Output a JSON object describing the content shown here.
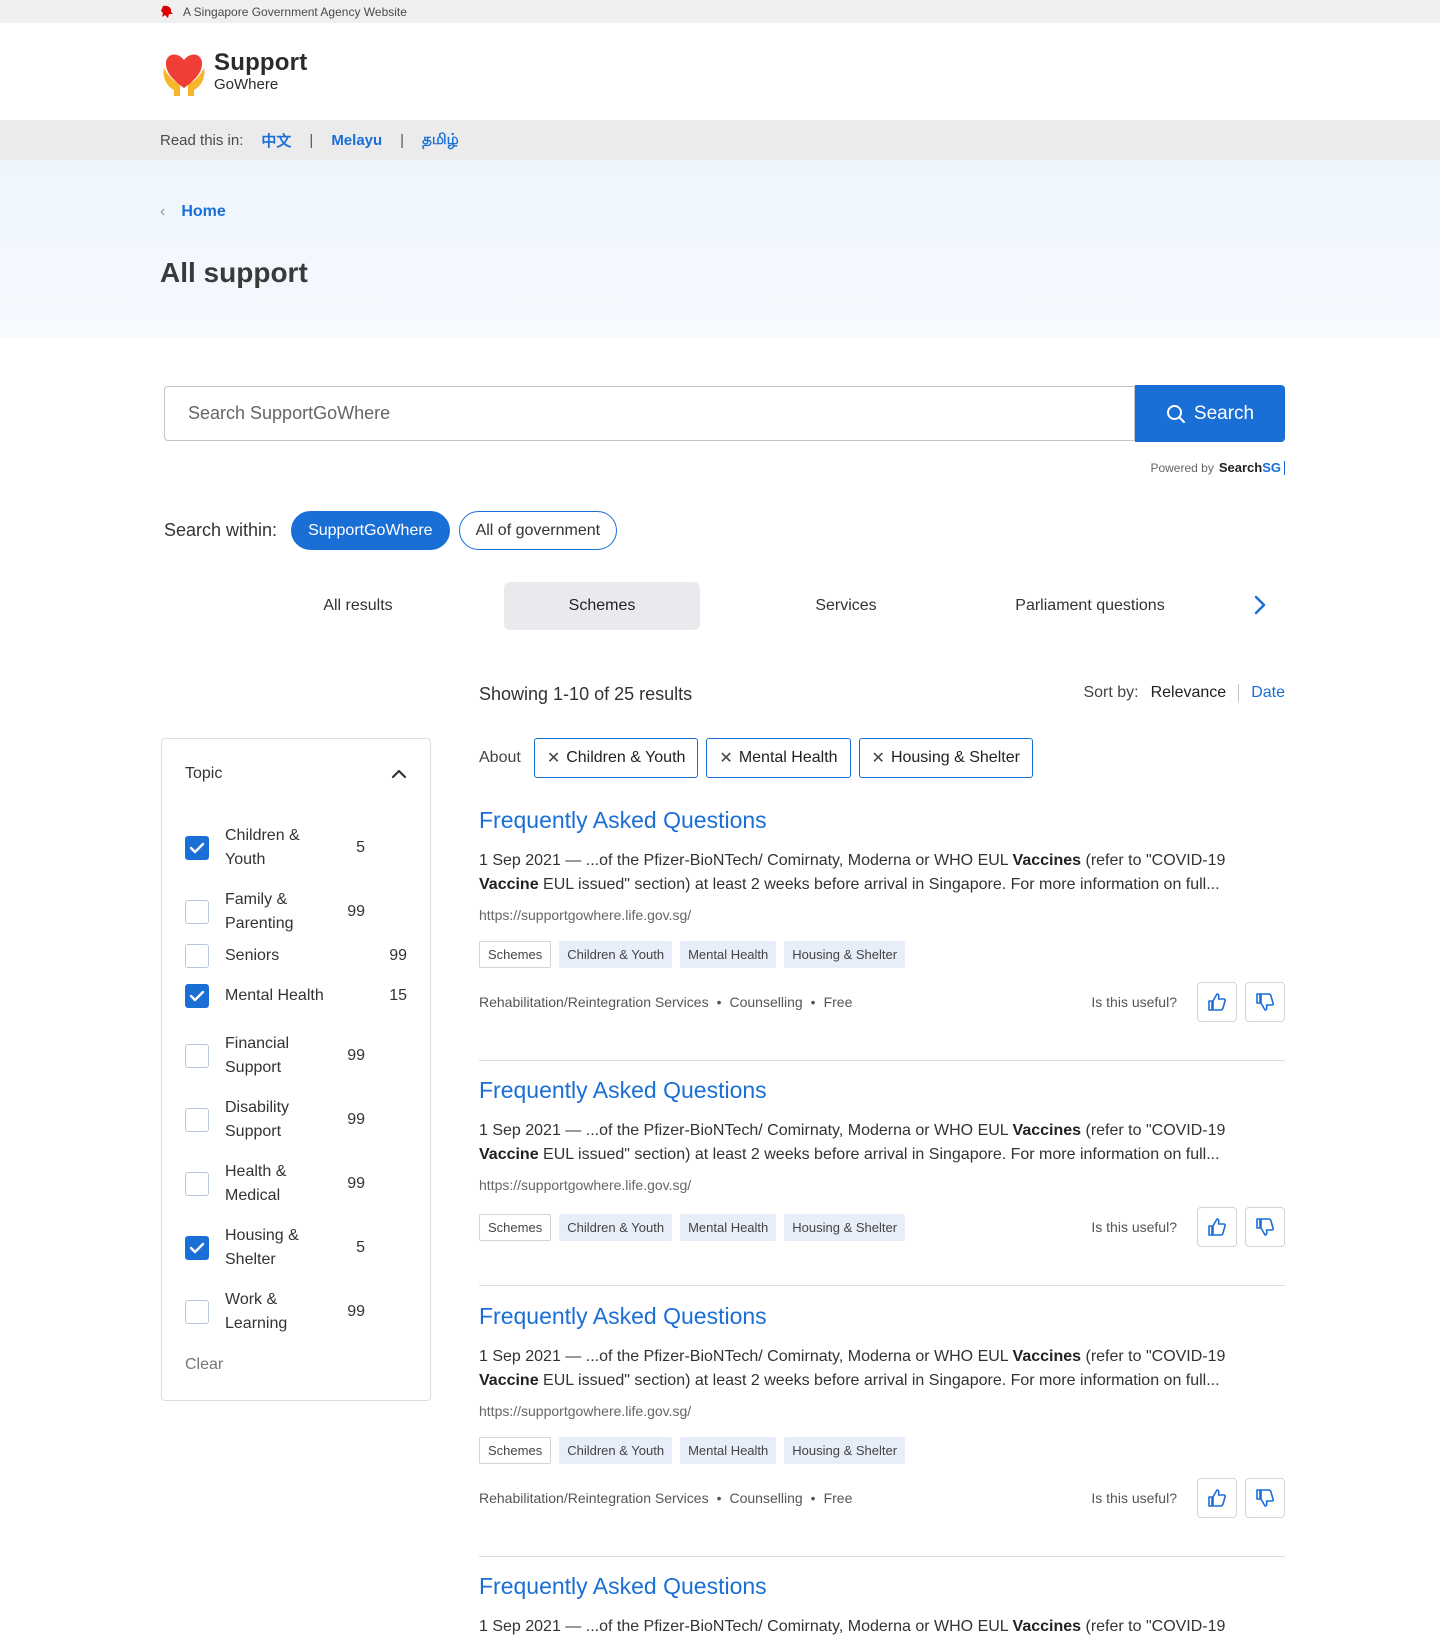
{
  "masthead": {
    "text": "A Singapore Government Agency Website"
  },
  "logo": {
    "title": "Support",
    "subtitle": "GoWhere"
  },
  "langbar": {
    "label": "Read this in:",
    "langs": [
      "中文",
      "Melayu",
      "தமிழ்"
    ]
  },
  "breadcrumb": {
    "home": "Home"
  },
  "page": {
    "title": "All support"
  },
  "search": {
    "placeholder": "Search SupportGoWhere",
    "button": "Search",
    "powered_by": "Powered by",
    "brand_a": "Search",
    "brand_b": "SG"
  },
  "within": {
    "label": "Search within:",
    "options": [
      "SupportGoWhere",
      "All of government"
    ]
  },
  "tabs": [
    "All results",
    "Schemes",
    "Services",
    "Parliament questions"
  ],
  "results_header": {
    "showing": "Showing 1-10 of 25 results",
    "sort_label": "Sort by:",
    "sort_relevance": "Relevance",
    "sort_date": "Date"
  },
  "sidebar": {
    "title": "Topic",
    "filters": [
      {
        "label": "Children & Youth",
        "count": "5",
        "checked": true
      },
      {
        "label": "Family & Parenting",
        "count": "99",
        "checked": false
      },
      {
        "label": "Seniors",
        "count": "99",
        "checked": false
      },
      {
        "label": "Mental Health",
        "count": "15",
        "checked": true
      },
      {
        "label": "Financial Support",
        "count": "99",
        "checked": false
      },
      {
        "label": "Disability Support",
        "count": "99",
        "checked": false
      },
      {
        "label": "Health & Medical",
        "count": "99",
        "checked": false
      },
      {
        "label": "Housing & Shelter",
        "count": "5",
        "checked": true
      },
      {
        "label": "Work & Learning",
        "count": "99",
        "checked": false
      }
    ],
    "clear": "Clear"
  },
  "about": {
    "label": "About",
    "chips": [
      "Children & Youth",
      "Mental Health",
      "Housing & Shelter"
    ]
  },
  "results": [
    {
      "title": "Frequently Asked Questions",
      "snippet_a": "1 Sep 2021 — ...of the Pfizer-BioNTech/ Comirnaty, Moderna or WHO EUL ",
      "snippet_b1": "Vaccines",
      "snippet_c": " (refer to \"COVID-19 ",
      "snippet_b2": "Vaccine",
      "snippet_d": " EUL issued\" section) at least 2 weeks before arrival in Singapore. For more information on full...",
      "url": "https://supportgowhere.life.gov.sg/",
      "tags": [
        "Schemes",
        "Children & Youth",
        "Mental Health",
        "Housing & Shelter"
      ],
      "meta": [
        "Rehabilitation/Reintegration Services",
        "Counselling",
        "Free"
      ],
      "useful": "Is this useful?"
    },
    {
      "title": "Frequently Asked Questions",
      "snippet_a": "1 Sep 2021 — ...of the Pfizer-BioNTech/ Comirnaty, Moderna or WHO EUL ",
      "snippet_b1": "Vaccines",
      "snippet_c": " (refer to \"COVID-19 ",
      "snippet_b2": "Vaccine",
      "snippet_d": " EUL issued\" section) at least 2 weeks before arrival in Singapore. For more information on full...",
      "url": "https://supportgowhere.life.gov.sg/",
      "tags": [
        "Schemes",
        "Children & Youth",
        "Mental Health",
        "Housing & Shelter"
      ],
      "meta": [],
      "useful": "Is this useful?"
    },
    {
      "title": "Frequently Asked Questions",
      "snippet_a": "1 Sep 2021 — ...of the Pfizer-BioNTech/ Comirnaty, Moderna or WHO EUL ",
      "snippet_b1": "Vaccines",
      "snippet_c": " (refer to \"COVID-19 ",
      "snippet_b2": "Vaccine",
      "snippet_d": " EUL issued\" section) at least 2 weeks before arrival in Singapore. For more information on full...",
      "url": "https://supportgowhere.life.gov.sg/",
      "tags": [
        "Schemes",
        "Children & Youth",
        "Mental Health",
        "Housing & Shelter"
      ],
      "meta": [
        "Rehabilitation/Reintegration Services",
        "Counselling",
        "Free"
      ],
      "useful": "Is this useful?"
    },
    {
      "title": "Frequently Asked Questions",
      "snippet_a": "1 Sep 2021 — ...of the Pfizer-BioNTech/ Comirnaty, Moderna or WHO EUL ",
      "snippet_b1": "Vaccines",
      "snippet_c": " (refer to \"COVID-19 ",
      "snippet_b2": "",
      "snippet_d": "",
      "url": "",
      "tags": [],
      "meta": [],
      "useful": ""
    }
  ],
  "colors": {
    "accent": "#1a6fd6",
    "tag_bg": "#e7eefa",
    "logo_heart": "#ef3e36",
    "logo_hands": "#f7b52c"
  },
  "icons": {
    "lion": "lion-head-icon",
    "search": "search-icon",
    "chevron_left": "chevron-left-icon",
    "chevron_up": "chevron-up-icon",
    "chevron_right": "chevron-right-icon",
    "check": "check-icon",
    "close": "close-icon",
    "thumbs_up": "thumbs-up-icon",
    "thumbs_down": "thumbs-down-icon"
  }
}
